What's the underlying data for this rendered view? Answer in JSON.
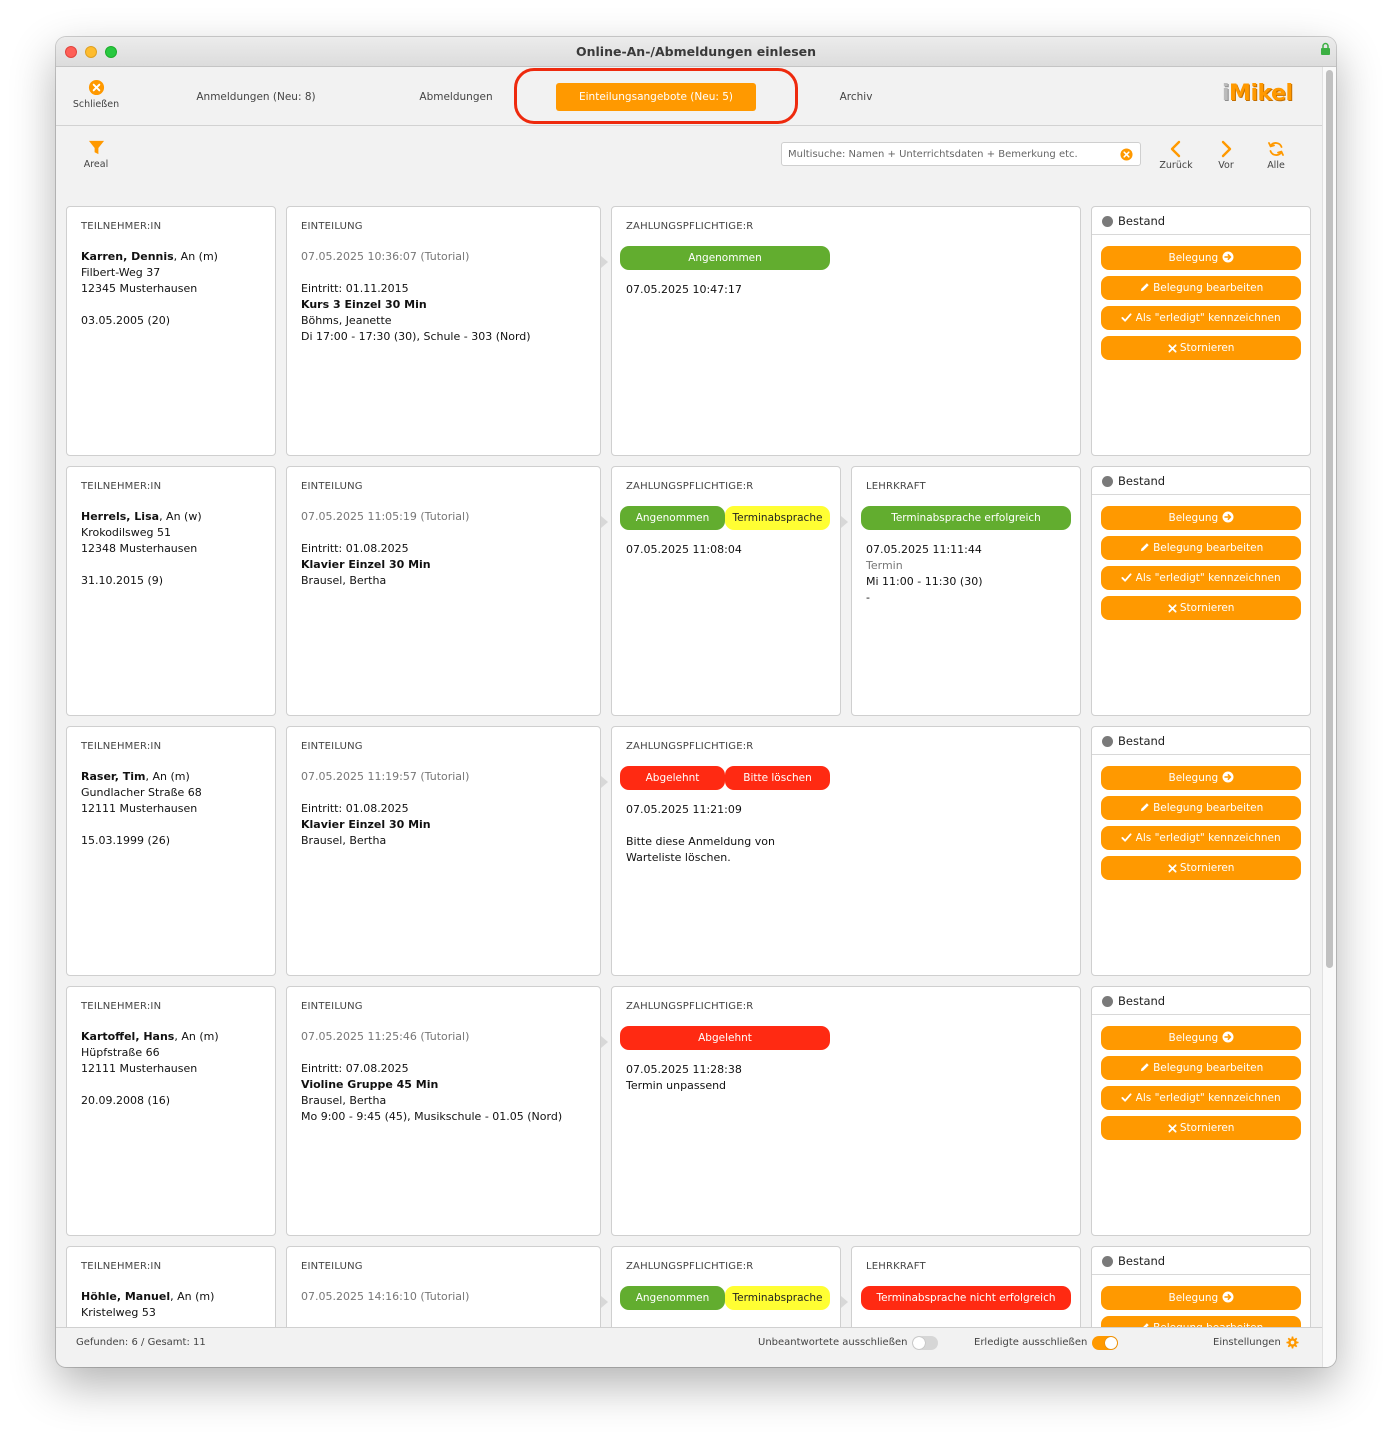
{
  "window": {
    "title": "Online-An-/Abmeldungen einlesen"
  },
  "toolbar": {
    "close_label": "Schließen",
    "tabs": [
      {
        "label": "Anmeldungen (Neu: 8)"
      },
      {
        "label": "Abmeldungen"
      },
      {
        "label": "Einteilungsangebote (Neu: 5)",
        "active": true
      },
      {
        "label": "Archiv"
      }
    ],
    "logo_i": "i",
    "logo_rest": "Mikel"
  },
  "toolbar2": {
    "filter_label": "Areal",
    "search_placeholder": "Multisuche: Namen + Unterrichtsdaten + Bemerkung etc.",
    "back_label": "Zurück",
    "forward_label": "Vor",
    "all_label": "Alle"
  },
  "labels": {
    "teilnehmer": "TEILNEHMER:IN",
    "einteilung": "EINTEILUNG",
    "zahlung": "ZAHLUNGSPFLICHTIGE:R",
    "lehrkraft": "LEHRKRAFT",
    "bestand": "Bestand",
    "belegung": "Belegung",
    "belegung_bearbeiten": "Belegung bearbeiten",
    "erledigt": "Als \"erledigt\" kennzeichnen",
    "stornieren": "Stornieren"
  },
  "colors": {
    "accent": "#ff9900",
    "green": "#62ad2f",
    "yellow": "#fffe33",
    "red": "#ff2a12",
    "ring": "#ee2a0e"
  },
  "entries": [
    {
      "name": "Karren, Dennis",
      "name_suffix": ", An (m)",
      "street": "Filbert-Weg 37",
      "city": "12345 Musterhausen",
      "birth": "03.05.2005 (20)",
      "timestamp": "07.05.2025 10:36:07 (Tutorial)",
      "eintritt": "Eintritt: 01.11.2015",
      "course": "Kurs 3 Einzel 30 Min",
      "teacher": "Böhms, Jeanette",
      "schedule": "Di 17:00 - 17:30 (30), Schule - 303 (Nord)",
      "pay_pills": [
        {
          "label": "Angenommen",
          "color": "green"
        }
      ],
      "pay_date": "07.05.2025 10:47:17",
      "pay_note": [
        "",
        ""
      ]
    },
    {
      "name": "Herrels, Lisa",
      "name_suffix": ", An (w)",
      "street": "Krokodilsweg 51",
      "city": "12348 Musterhausen",
      "birth": "31.10.2015 (9)",
      "timestamp": "07.05.2025 11:05:19 (Tutorial)",
      "eintritt": "Eintritt: 01.08.2025",
      "course": "Klavier Einzel 30 Min",
      "teacher": "Brausel, Bertha",
      "schedule": "",
      "pay_pills": [
        {
          "label": "Angenommen",
          "color": "green"
        },
        {
          "label": "Terminabsprache",
          "color": "yellow"
        }
      ],
      "pay_date": "07.05.2025 11:08:04",
      "pay_note": [
        "",
        ""
      ],
      "lehrkraft": {
        "pill": "Terminabsprache erfolgreich",
        "color": "green",
        "date": "07.05.2025 11:11:44",
        "termin_label": "Termin",
        "termin": "Mi 11:00 - 11:30 (30)",
        "extra": " -"
      }
    },
    {
      "name": "Raser, Tim",
      "name_suffix": ", An (m)",
      "street": "Gundlacher Straße 68",
      "city": "12111 Musterhausen",
      "birth": "15.03.1999 (26)",
      "timestamp": "07.05.2025 11:19:57 (Tutorial)",
      "eintritt": "Eintritt: 01.08.2025",
      "course": "Klavier Einzel 30 Min",
      "teacher": "Brausel, Bertha",
      "schedule": "",
      "pay_pills": [
        {
          "label": "Abgelehnt",
          "color": "red"
        },
        {
          "label": "Bitte löschen",
          "color": "red"
        }
      ],
      "pay_date": "07.05.2025 11:21:09",
      "pay_note": [
        "Bitte diese Anmeldung von",
        "Warteliste löschen."
      ]
    },
    {
      "name": "Kartoffel, Hans",
      "name_suffix": ", An (m)",
      "street": "Hüpfstraße 66",
      "city": "12111 Musterhausen",
      "birth": "20.09.2008 (16)",
      "timestamp": "07.05.2025 11:25:46 (Tutorial)",
      "eintritt": "Eintritt: 07.08.2025",
      "course": "Violine Gruppe 45 Min",
      "teacher": "Brausel, Bertha",
      "schedule": "Mo 9:00 - 9:45 (45), Musikschule - 01.05 (Nord)",
      "pay_pills": [
        {
          "label": "Abgelehnt",
          "color": "red"
        }
      ],
      "pay_date": "07.05.2025 11:28:38",
      "pay_note": [
        "Termin unpassend",
        ""
      ]
    },
    {
      "name": "Höhle, Manuel",
      "name_suffix": ", An (m)",
      "street": "Kristelweg 53",
      "city": "",
      "birth": "",
      "timestamp": "07.05.2025 14:16:10 (Tutorial)",
      "eintritt": "",
      "course": "",
      "teacher": "",
      "schedule": "",
      "pay_pills": [
        {
          "label": "Angenommen",
          "color": "green"
        },
        {
          "label": "Terminabsprache",
          "color": "yellow"
        }
      ],
      "pay_date": "",
      "pay_note": [
        "",
        ""
      ],
      "lehrkraft": {
        "pill": "Terminabsprache nicht erfolgreich",
        "color": "red",
        "date": "",
        "termin_label": "",
        "termin": "",
        "extra": ""
      }
    }
  ],
  "status": {
    "found": "Gefunden: 6 / Gesamt: 11",
    "unanswered_label": "Unbeantwortete ausschließen",
    "unanswered_on": false,
    "done_label": "Erledigte ausschließen",
    "done_on": true,
    "settings_label": "Einstellungen"
  }
}
